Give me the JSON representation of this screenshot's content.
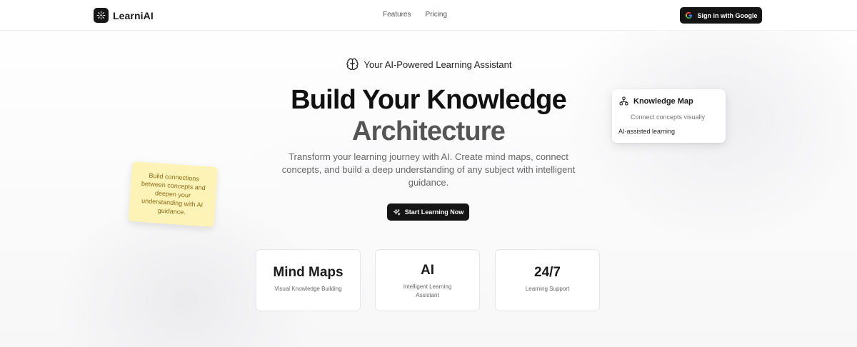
{
  "header": {
    "brand": "LearniAI",
    "nav": [
      "Features",
      "Pricing"
    ],
    "signin_label": "Sign in with Google"
  },
  "hero": {
    "badge": "Your AI-Powered Learning Assistant",
    "title_line1": "Build Your Knowledge",
    "title_line2": "Architecture",
    "subtitle": "Transform your learning journey with AI. Create mind maps, connect concepts, and build a deep understanding of any subject with intelligent guidance.",
    "cta_label": "Start Learning Now"
  },
  "knowledge_card": {
    "title": "Knowledge Map",
    "subtitle": "Connect concepts visually",
    "footer": "AI-assisted learning"
  },
  "sticky_note": {
    "text": "Build connections between concepts and deepen your understanding with AI guidance."
  },
  "stats": [
    {
      "value": "Mind Maps",
      "label": "Visual Knowledge Building"
    },
    {
      "value": "AI",
      "label": "Intelligent Learning Assistant"
    },
    {
      "value": "24/7",
      "label": "Learning Support"
    }
  ],
  "colors": {
    "primary_button": "#141414",
    "sticky_bg": "#fdf3b6",
    "sticky_text": "#8a6b1a",
    "title_dark": "#111111",
    "title_muted": "#555555"
  },
  "icons": {
    "logo": "sparkle-burst-icon",
    "signin": "google-g-icon",
    "badge": "brain-icon",
    "cta": "sparkles-icon",
    "knowledge_card": "network-icon"
  }
}
